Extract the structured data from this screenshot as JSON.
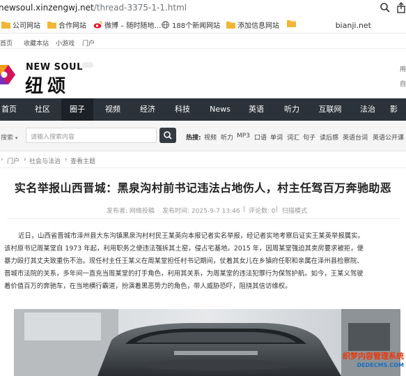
{
  "browser": {
    "url_host": "newsoul.xinzengwj.net",
    "url_path": "/thread-3375-1-1.html"
  },
  "bookmarks": {
    "items": [
      {
        "label": "公司网站",
        "icon": "folder-icon"
      },
      {
        "label": "合作网站",
        "icon": "folder-icon"
      },
      {
        "label": "微博 – 随时随地…",
        "icon": "weibo-icon"
      },
      {
        "label": "188个新闻网站",
        "icon": "globe-icon"
      },
      {
        "label": "添加信息网站",
        "icon": "folder-icon"
      },
      {
        "label": "",
        "icon": "folder-icon"
      }
    ],
    "right_text": "bianji.net"
  },
  "toplinks": {
    "items": [
      "首页",
      "收藏本站",
      "小游戏",
      "门户"
    ]
  },
  "logo": {
    "en": "NEW SOUL",
    "cn": "纽颂",
    "side_top": "用",
    "side_bottom": "自"
  },
  "nav": {
    "items": [
      "首页",
      "社区",
      "圈子",
      "视频",
      "经济",
      "科技",
      "News",
      "英语",
      "听力",
      "互联网",
      "法治",
      "影"
    ],
    "active": "圈子"
  },
  "search": {
    "type_label": "搜索",
    "placeholder": "请输入搜索内容",
    "hot_label": "热搜:",
    "hot_terms": [
      "视频",
      "听力",
      "MP3",
      "口语",
      "单词",
      "词汇",
      "句子",
      "读后感",
      "英语台词",
      "英语公开课"
    ]
  },
  "breadcrumb": {
    "items": [
      "门户",
      "社会与法治",
      "查看主题"
    ]
  },
  "article": {
    "title": "实名举报山西晋城：黑泉沟村前书记违法占地伤人，村主任驾百万奔驰助恶",
    "author": "发布者: 网络投稿",
    "time": "发布时间: 2025-9-7 13:46",
    "comments": "评论数: 0",
    "mode": "扫描模式",
    "paragraphs": [
      "近日，山西省晋城市泽州县大东沟镇黑泉沟村村民王某英向本报记者实名举报，经记者实地考察后证实王某英举报属实。",
      "该村原书记周某堂自 1973 年起，利用职务之便违法强拆其土窑，侵占宅基地。2015 年，因周某堂强迫其卖房要求被拒，便",
      "暴力殴打其丈夫致重伤不治。现任村主任王某义在周某堂担任村书记期间，仗着其女儿在乡镇府任职和亲属在泽州县检察院、",
      "晋城市法院的关系，多年间一直充当周某堂的打手角色，利用其关系，为周某堂的违法犯罪行为保驾护航。如今，王某义驾驶",
      "着价值百万的奔驰车，在当地横行霸道，扮演着黑恶势力的角色，带人威胁恐吓，阻挠其信访维权。"
    ]
  },
  "watermark": {
    "line1": "织梦内容管理系统",
    "line2": "DEDECMS.COM"
  },
  "colors": {
    "nav_bg": "#2b323a",
    "nav_active": "#1c2127",
    "watermark_red": "#e8380d",
    "watermark_blue": "#1a6ec2"
  }
}
